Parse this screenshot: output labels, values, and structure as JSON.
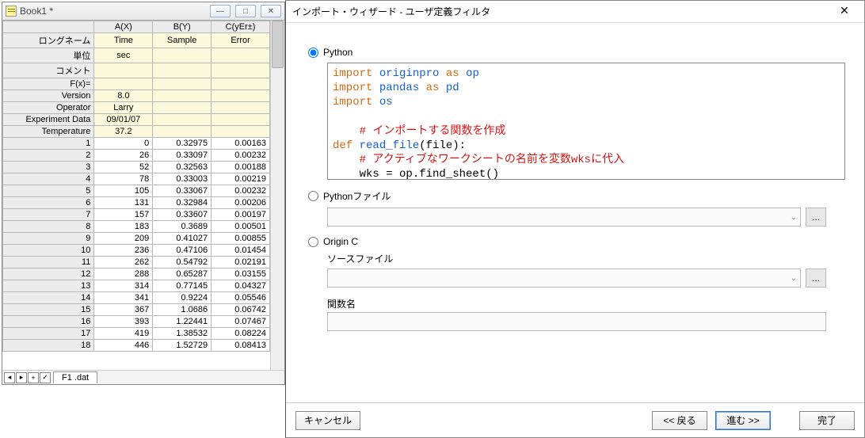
{
  "worksheet": {
    "title": "Book1 *",
    "tab": "F1 .dat",
    "colHeaders": [
      "A(X)",
      "B(Y)",
      "C(yEr±)"
    ],
    "metaRows": [
      {
        "label": "ロングネーム",
        "cells": [
          "Time",
          "Sample",
          "Error"
        ]
      },
      {
        "label": "単位",
        "cells": [
          "sec",
          "",
          ""
        ]
      },
      {
        "label": "コメント",
        "cells": [
          "",
          "",
          ""
        ]
      },
      {
        "label": "F(x)=",
        "cells": [
          "",
          "",
          ""
        ]
      },
      {
        "label": "Version",
        "cells": [
          "8.0",
          "",
          ""
        ]
      },
      {
        "label": "Operator",
        "cells": [
          "Larry",
          "",
          ""
        ]
      },
      {
        "label": "Experiment Data",
        "cells": [
          "09/01/07",
          "",
          ""
        ]
      },
      {
        "label": "Temperature",
        "cells": [
          "37.2",
          "",
          ""
        ]
      }
    ],
    "dataRows": [
      {
        "n": "1",
        "cells": [
          "0",
          "0.32975",
          "0.00163"
        ]
      },
      {
        "n": "2",
        "cells": [
          "26",
          "0.33097",
          "0.00232"
        ]
      },
      {
        "n": "3",
        "cells": [
          "52",
          "0.32563",
          "0.00188"
        ]
      },
      {
        "n": "4",
        "cells": [
          "78",
          "0.33003",
          "0.00219"
        ]
      },
      {
        "n": "5",
        "cells": [
          "105",
          "0.33067",
          "0.00232"
        ]
      },
      {
        "n": "6",
        "cells": [
          "131",
          "0.32984",
          "0.00206"
        ]
      },
      {
        "n": "7",
        "cells": [
          "157",
          "0.33607",
          "0.00197"
        ]
      },
      {
        "n": "8",
        "cells": [
          "183",
          "0.3689",
          "0.00501"
        ]
      },
      {
        "n": "9",
        "cells": [
          "209",
          "0.41027",
          "0.00855"
        ]
      },
      {
        "n": "10",
        "cells": [
          "236",
          "0.47106",
          "0.01454"
        ]
      },
      {
        "n": "11",
        "cells": [
          "262",
          "0.54792",
          "0.02191"
        ]
      },
      {
        "n": "12",
        "cells": [
          "288",
          "0.65287",
          "0.03155"
        ]
      },
      {
        "n": "13",
        "cells": [
          "314",
          "0.77145",
          "0.04327"
        ]
      },
      {
        "n": "14",
        "cells": [
          "341",
          "0.9224",
          "0.05546"
        ]
      },
      {
        "n": "15",
        "cells": [
          "367",
          "1.0686",
          "0.06742"
        ]
      },
      {
        "n": "16",
        "cells": [
          "393",
          "1.22441",
          "0.07467"
        ]
      },
      {
        "n": "17",
        "cells": [
          "419",
          "1.38532",
          "0.08224"
        ]
      },
      {
        "n": "18",
        "cells": [
          "446",
          "1.52729",
          "0.08413"
        ]
      }
    ]
  },
  "dialog": {
    "title": "インポート・ウィザード - ユーザ定義フィルタ",
    "radios": {
      "python": "Python",
      "pythonFile": "Pythonファイル",
      "originC": "Origin C"
    },
    "labels": {
      "sourceFile": "ソースファイル",
      "funcName": "関数名"
    },
    "code": {
      "l1a": "import",
      "l1b": "originpro",
      "l1c": "as",
      "l1d": "op",
      "l2a": "import",
      "l2b": "pandas",
      "l2c": "as",
      "l2d": "pd",
      "l3a": "import",
      "l3b": "os",
      "l5": "    # インポートする関数を作成",
      "l6a": "def",
      "l6b": "read_file",
      "l6c": "(file):",
      "l7": "    # アクティブなワークシートの名前を変数wksに代入",
      "l8": "    wks = op.find_sheet()"
    },
    "buttons": {
      "cancel": "キャンセル",
      "back": "<< 戻る",
      "next": "進む >>",
      "finish": "完了"
    }
  }
}
